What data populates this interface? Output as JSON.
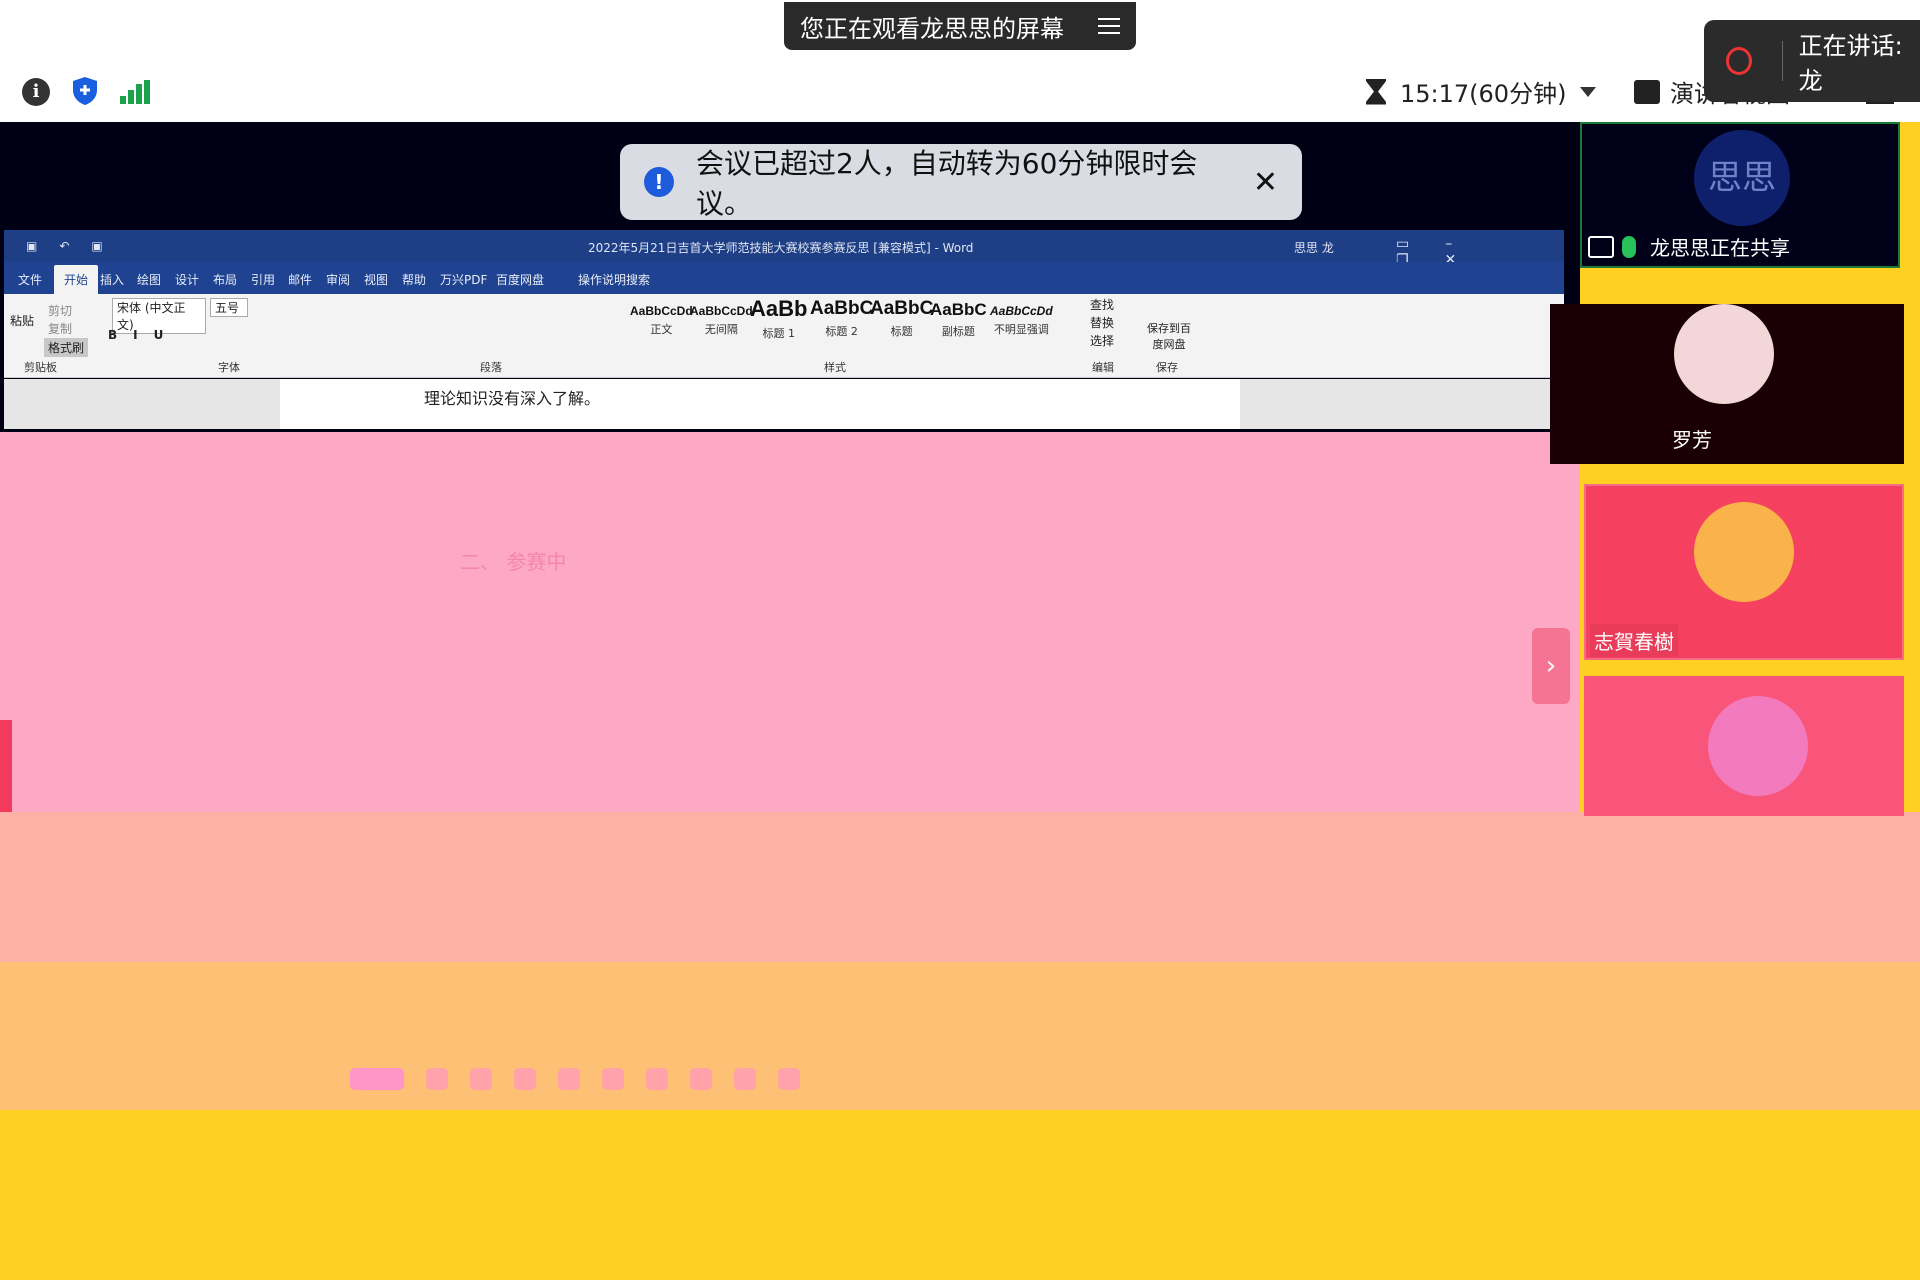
{
  "topbar": {
    "banner_text": "您正在观看龙思思的屏幕",
    "timer_text": "15:17(60分钟)",
    "view_label": "演讲者视图",
    "speaking_text": "正在讲话: 龙"
  },
  "toast": {
    "text": "会议已超过2人，自动转为60分钟限时会议。",
    "close": "✕"
  },
  "word": {
    "title": "2022年5月21日吉首大学师范技能大赛校赛参赛反思 [兼容模式] - Word",
    "user": "思思 龙",
    "menu": [
      "文件",
      "开始",
      "插入",
      "绘图",
      "设计",
      "布局",
      "引用",
      "邮件",
      "审阅",
      "视图",
      "帮助",
      "万兴PDF",
      "百度网盘",
      "操作说明搜索"
    ],
    "clipboard": {
      "paste": "粘贴",
      "cut": "剪切",
      "copy": "复制",
      "format_painter": "格式刷",
      "group": "剪贴板"
    },
    "font_name": "宋体 (中文正文)",
    "font_size": "五号",
    "groups": {
      "font": "字体",
      "paragraph": "段落",
      "styles": "样式",
      "edit": "编辑",
      "save": "保存"
    },
    "styles": [
      {
        "sample": "AaBbCcDd",
        "name": "正文"
      },
      {
        "sample": "AaBbCcDd",
        "name": "无间隔"
      },
      {
        "sample": "AaBb",
        "name": "标题 1"
      },
      {
        "sample": "AaBbC",
        "name": "标题 2"
      },
      {
        "sample": "AaBbC",
        "name": "标题"
      },
      {
        "sample": "AaBbC",
        "name": "副标题"
      },
      {
        "sample": "AaBbCcDd",
        "name": "不明显强调"
      }
    ],
    "edit_items": [
      "查找",
      "替换",
      "选择"
    ],
    "save_label": "保存到百度网盘",
    "doc_line": "理论知识没有深入了解。"
  },
  "ghost": {
    "heading": "二、  参赛中"
  },
  "participants": [
    {
      "name": "龙思思正在共享",
      "avatar_text": "思思"
    },
    {
      "name": "罗芳"
    },
    {
      "name": "志賀春樹"
    },
    {
      "name": ""
    }
  ],
  "colors": {
    "share_bg": "#000014",
    "word_blue": "#1e3f86",
    "glitch_pink": "#fda9c6",
    "glitch_yellow": "#ffd021"
  }
}
